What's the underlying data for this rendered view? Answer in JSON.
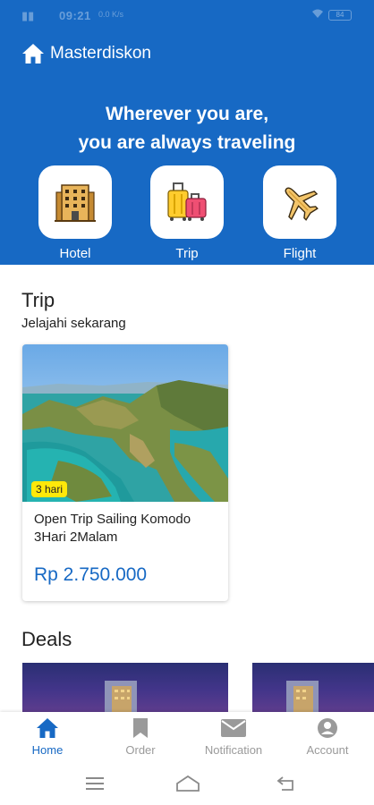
{
  "status_bar": {
    "time": "09:21",
    "network": "0.0 K/s",
    "battery": "84"
  },
  "brand": {
    "name": "Masterdiskon",
    "icon": "home-icon"
  },
  "hero": {
    "line1": "Wherever you are,",
    "line2": "you are always traveling"
  },
  "categories": [
    {
      "label": "Hotel",
      "icon": "hotel-icon"
    },
    {
      "label": "Trip",
      "icon": "luggage-icon"
    },
    {
      "label": "Flight",
      "icon": "airplane-icon"
    }
  ],
  "trip_section": {
    "title": "Trip",
    "subtitle": "Jelajahi sekarang",
    "cards": [
      {
        "badge": "3 hari",
        "name": "Open Trip Sailing Komodo 3Hari 2Malam",
        "price": "Rp 2.750.000"
      }
    ]
  },
  "deals_section": {
    "title": "Deals"
  },
  "bottom_nav": [
    {
      "label": "Home",
      "icon": "home-icon",
      "active": true
    },
    {
      "label": "Order",
      "icon": "bookmark-icon",
      "active": false
    },
    {
      "label": "Notification",
      "icon": "mail-icon",
      "active": false
    },
    {
      "label": "Account",
      "icon": "account-icon",
      "active": false
    }
  ],
  "colors": {
    "primary": "#1769c4",
    "badge": "#ffe80a",
    "inactive": "#9a9a9a"
  }
}
